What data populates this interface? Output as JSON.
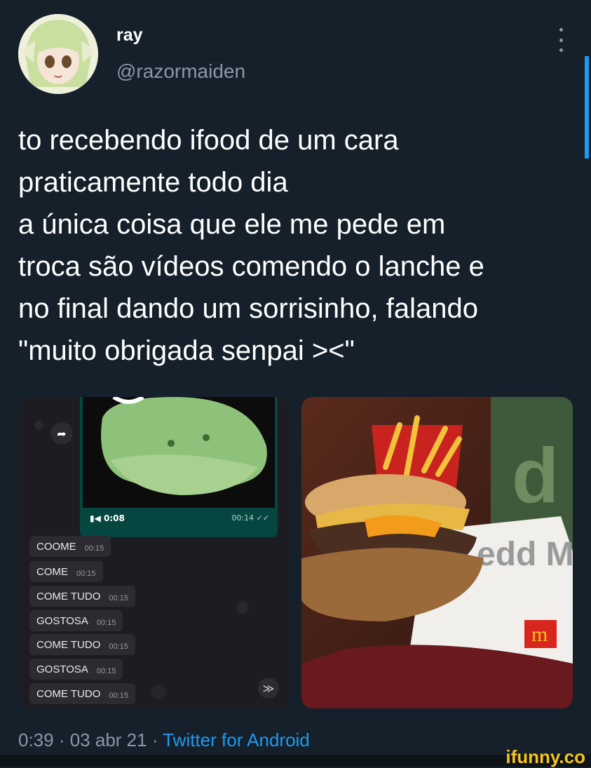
{
  "author": {
    "name": "ray",
    "handle": "@razormaiden"
  },
  "tweet": {
    "lines": [
      "to recebendo ifood de um cara",
      "praticamente todo dia",
      "a única coisa que ele me pede em",
      "troca são vídeos comendo o lanche e",
      "no final dando um sorrisinho, falando",
      "\"muito obrigada senpai ><\""
    ]
  },
  "chat": {
    "video_duration": "0:08",
    "video_time": "00:14",
    "messages": [
      {
        "text": "COOME",
        "time": "00:15"
      },
      {
        "text": "COME",
        "time": "00:15"
      },
      {
        "text": "COME TUDO",
        "time": "00:15"
      },
      {
        "text": "GOSTOSA",
        "time": "00:15"
      },
      {
        "text": "COME TUDO",
        "time": "00:15"
      },
      {
        "text": "GOSTOSA",
        "time": "00:15"
      },
      {
        "text": "COME TUDO",
        "time": "00:15"
      }
    ]
  },
  "photo": {
    "box_text": "edd Me",
    "logo": "m"
  },
  "meta": {
    "time": "0:39",
    "date": "03 abr 21",
    "separator": " · ",
    "source": "Twitter for Android"
  },
  "watermark": "ifunny.co",
  "colors": {
    "background": "#15202b",
    "secondary_text": "#8899a6",
    "accent": "#1d9bf0",
    "watermark": "#f5c518"
  }
}
